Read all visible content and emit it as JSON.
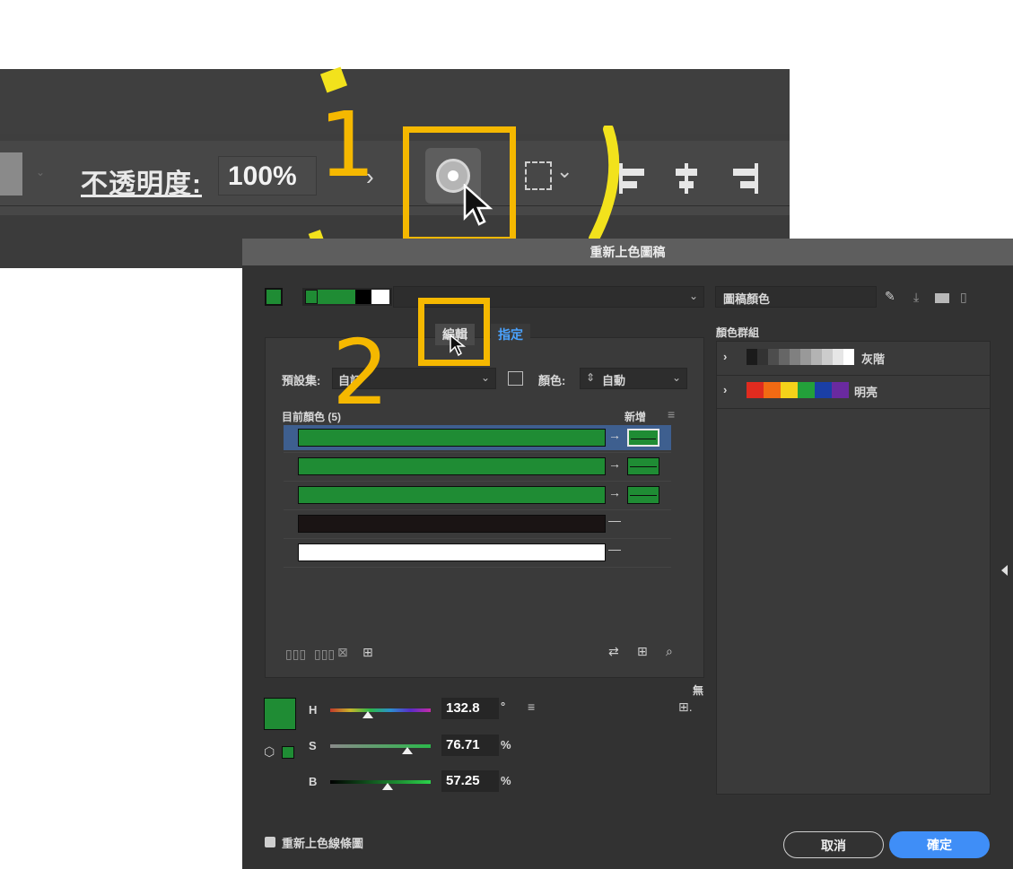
{
  "toolbar": {
    "opacity_label": "不透明度:",
    "opacity_value": "100%",
    "chevron": "›",
    "icons": [
      "recolor-artwork-icon",
      "transform-icon",
      "align-left-icon",
      "align-center-icon",
      "align-right-icon"
    ]
  },
  "annotations": {
    "step1": "1",
    "step2": "2",
    "highlight_color": "#f5b800",
    "stroke_color": "#f2e21c"
  },
  "dialog": {
    "title": "重新上色圖稿",
    "tabs": {
      "edit": "編輯",
      "assign": "指定"
    },
    "preset_label": "預設集:",
    "preset_value": "自訂",
    "colors_label": "顏色:",
    "colors_value": "自動",
    "current_colors_label": "目前顏色 (5)",
    "new_label": "新增",
    "rows": [
      {
        "current": "#1f8c34",
        "new": "#1f8c34",
        "mapping": "arrow"
      },
      {
        "current": "#1f8c34",
        "new": "#1f8c34",
        "mapping": "arrow"
      },
      {
        "current": "#1f8c34",
        "new": "#1f8c34",
        "mapping": "arrow"
      },
      {
        "current": "#1a1414",
        "new": "",
        "mapping": "none"
      },
      {
        "current": "#ffffff",
        "new": "",
        "mapping": "none"
      }
    ],
    "none_label": "無",
    "hsb": {
      "h_label": "H",
      "h_value": "132.8",
      "h_unit": "°",
      "s_label": "S",
      "s_value": "76.71",
      "s_unit": "%",
      "b_label": "B",
      "b_value": "57.25",
      "b_unit": "%"
    },
    "right_panel": {
      "artwork_colors": "圖稿顏色",
      "color_groups_label": "顏色群組",
      "groups": [
        {
          "name": "灰階",
          "colors": [
            "#1b1b1b",
            "#333333",
            "#4d4d4d",
            "#666666",
            "#808080",
            "#999999",
            "#b3b3b3",
            "#cccccc",
            "#e6e6e6",
            "#ffffff"
          ]
        },
        {
          "name": "明亮",
          "colors": [
            "#e02b1f",
            "#f26a13",
            "#f5d21a",
            "#23a03a",
            "#1a3fa6",
            "#6a2aa0"
          ]
        }
      ]
    },
    "recolor_checkbox": "重新上色線條圖",
    "cancel": "取消",
    "ok": "確定"
  }
}
